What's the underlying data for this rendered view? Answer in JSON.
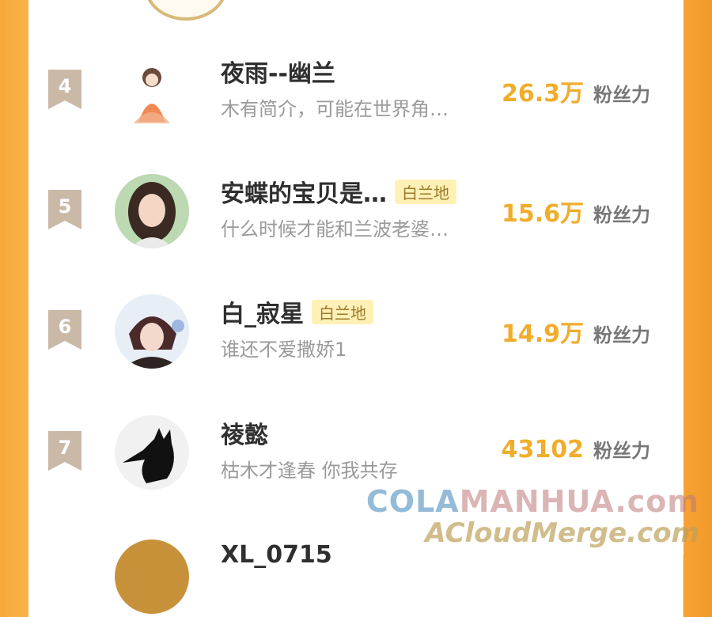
{
  "rows": [
    {
      "rank": "4",
      "name": "夜雨--幽兰",
      "tag": "",
      "desc": "木有简介，可能在世界角…",
      "fans": "26.3万",
      "unit": "粉丝力",
      "avatar_icon": "girl-orange-dress-avatar-icon"
    },
    {
      "rank": "5",
      "name": "安蝶的宝贝是…",
      "tag": "白兰地",
      "desc": "什么时候才能和兰波老婆…",
      "fans": "15.6万",
      "unit": "粉丝力",
      "avatar_icon": "girl-photo-avatar-icon"
    },
    {
      "rank": "6",
      "name": "白_寂星",
      "tag": "白兰地",
      "desc": "谁还不爱撒娇1",
      "fans": "14.9万",
      "unit": "粉丝力",
      "avatar_icon": "anime-boy-avatar-icon"
    },
    {
      "rank": "7",
      "name": "祾懿",
      "tag": "",
      "desc": "枯木才逢春 你我共存",
      "fans": "43102",
      "unit": "粉丝力",
      "avatar_icon": "black-cat-avatar-icon"
    },
    {
      "rank": "",
      "name": "XL_0715",
      "tag": "",
      "desc": "",
      "fans": "",
      "unit": "",
      "avatar_icon": "partial-avatar-icon"
    }
  ],
  "watermark": {
    "line1_a": "COLA",
    "line1_b": "MANHUA.com",
    "line2": "ACloudMerge.com"
  },
  "colors": {
    "accent": "#f0ad2b",
    "frame": "#f7a93a",
    "tag_bg": "#fff0b6"
  }
}
